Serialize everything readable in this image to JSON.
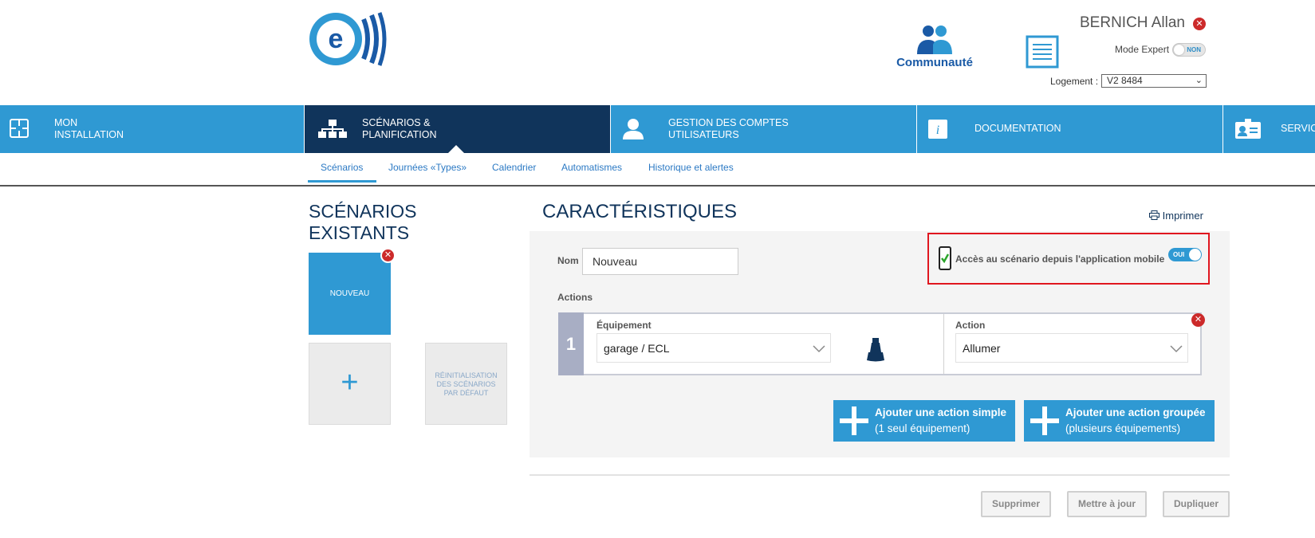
{
  "header": {
    "community_label": "Communauté",
    "user_name": "BERNICH Allan",
    "mode_label": "Mode Expert",
    "mode_toggle_text": "NON",
    "logement_label": "Logement :",
    "logement_value": "V2 8484"
  },
  "nav": {
    "items": [
      {
        "label": "MON\nINSTALLATION",
        "icon": "floorplan-icon"
      },
      {
        "label": "SCÉNARIOS &\nPLANIFICATION",
        "icon": "scenario-network-icon",
        "active": true
      },
      {
        "label": "GESTION DES COMPTES\nUTILISATEURS",
        "icon": "user-icon"
      },
      {
        "label": "DOCUMENTATION",
        "icon": "info-icon"
      },
      {
        "label": "SERVIC",
        "icon": "id-card-icon"
      }
    ],
    "accent_color": "#2f99d3",
    "active_color": "#10345b"
  },
  "subnav": {
    "items": [
      "Scénarios",
      "Journées «Types»",
      "Calendrier",
      "Automatismes",
      "Historique et alertes"
    ],
    "active": "Scénarios"
  },
  "left": {
    "title_line1": "SCÉNARIOS",
    "title_line2": "EXISTANTS",
    "card_label": "NOUVEAU",
    "add_symbol": "+",
    "reset_label_l1": "RÉINITIALISATION",
    "reset_label_l2": "DES SCÉNARIOS",
    "reset_label_l3": "PAR DÉFAUT"
  },
  "main": {
    "title": "CARACTÉRISTIQUES",
    "print_label": "Imprimer",
    "nom_label": "Nom",
    "nom_value": "Nouveau",
    "mobile_access_label": "Accès au scénario depuis l'application mobile",
    "mobile_toggle_text": "OUI",
    "actions_label": "Actions",
    "action_row": {
      "number": "1",
      "equipment_label": "Équipement",
      "equipment_value": "garage / ECL",
      "action_label": "Action",
      "action_value": "Allumer"
    },
    "add_simple_line1": "Ajouter une action simple",
    "add_simple_line2": "(1 seul équipement)",
    "add_group_line1": "Ajouter une action groupée",
    "add_group_line2": "(plusieurs équipements)",
    "btn_delete": "Supprimer",
    "btn_update": "Mettre à jour",
    "btn_duplicate": "Dupliquer"
  }
}
